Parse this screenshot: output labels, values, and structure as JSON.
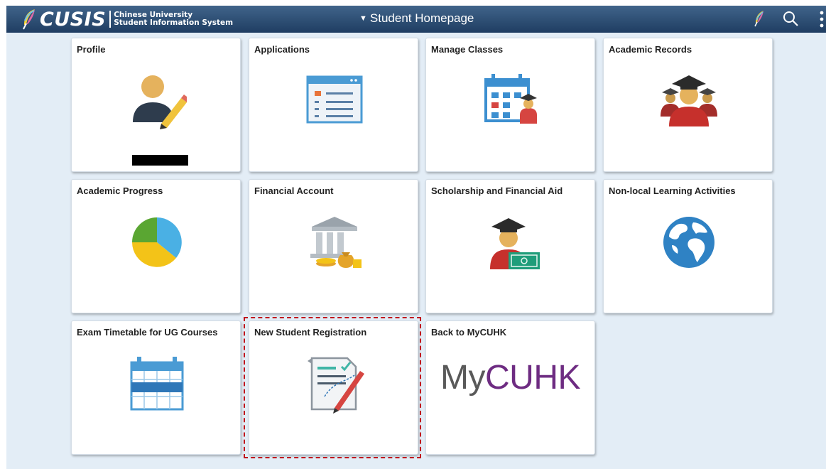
{
  "header": {
    "logo_text": "CUSIS",
    "logo_sub_line1": "Chinese University",
    "logo_sub_line2": "Student Information System",
    "nav_caret": "▼",
    "nav_title": "Student Homepage",
    "icons": [
      "feather-icon",
      "search-icon",
      "more-options-icon"
    ]
  },
  "tiles": [
    {
      "title": "Profile",
      "icon": "profile-edit-icon"
    },
    {
      "title": "Applications",
      "icon": "application-form-icon"
    },
    {
      "title": "Manage Classes",
      "icon": "class-calendar-icon"
    },
    {
      "title": "Academic Records",
      "icon": "graduates-icon"
    },
    {
      "title": "Academic Progress",
      "icon": "pie-chart-icon"
    },
    {
      "title": "Financial Account",
      "icon": "bank-money-icon"
    },
    {
      "title": "Scholarship and Financial Aid",
      "icon": "graduate-cash-icon"
    },
    {
      "title": "Non-local Learning Activities",
      "icon": "globe-icon"
    },
    {
      "title": "Exam Timetable for UG Courses",
      "icon": "calendar-icon"
    },
    {
      "title": "New Student Registration",
      "icon": "registration-form-icon"
    },
    {
      "title": "Back to MyCUHK",
      "icon": "mycuhk-logo"
    }
  ],
  "mycuhk_logo": {
    "prefix": "My",
    "suffix": "CUHK"
  },
  "colors": {
    "header_top": "#40648a",
    "header_bottom": "#1f3d62",
    "page_background": "#e3edf6",
    "highlight_border": "#c0121c",
    "mycuhk_purple": "#6e2c82"
  }
}
